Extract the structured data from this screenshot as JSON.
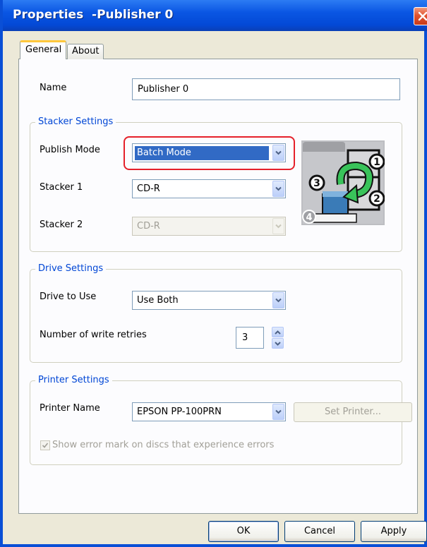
{
  "window": {
    "title": "Properties  -Publisher 0"
  },
  "tabs": [
    {
      "label": "General",
      "active": true
    },
    {
      "label": "About",
      "active": false
    }
  ],
  "general": {
    "name_label": "Name",
    "name_value": "Publisher 0"
  },
  "stacker_settings": {
    "title": "Stacker Settings",
    "publish_mode_label": "Publish Mode",
    "publish_mode_value": "Batch Mode",
    "stacker1_label": "Stacker 1",
    "stacker1_value": "CD-R",
    "stacker2_label": "Stacker 2",
    "stacker2_value": "CD-R",
    "diagram_numbers": [
      "1",
      "2",
      "3",
      "4"
    ]
  },
  "drive_settings": {
    "title": "Drive Settings",
    "drive_label": "Drive to Use",
    "drive_value": "Use Both",
    "retries_label": "Number of write retries",
    "retries_value": "3"
  },
  "printer_settings": {
    "title": "Printer Settings",
    "printer_label": "Printer Name",
    "printer_value": "EPSON PP-100PRN",
    "set_printer_label": "Set Printer...",
    "error_mark_label": "Show error mark on discs that experience errors",
    "error_mark_checked": true
  },
  "buttons": {
    "ok": "OK",
    "cancel": "Cancel",
    "apply": "Apply"
  },
  "colors": {
    "titlebar": "#0A56E3",
    "group_title": "#0046D5",
    "highlight_ring": "#E5202A",
    "selection": "#316AC5"
  },
  "icons": {
    "close": "close-icon",
    "dropdown": "chevron-down-icon",
    "spin_up": "spin-up-icon",
    "spin_down": "spin-down-icon",
    "checkbox": "checkmark-icon",
    "stacker_diagram": "stacker-diagram-icon"
  }
}
